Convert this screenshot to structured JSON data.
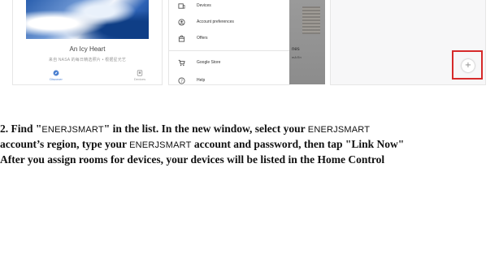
{
  "photo_card": {
    "title": "An Icy Heart",
    "caption": "来自 NASA 的每日精选照片 • 根据星光艺",
    "nav": [
      {
        "label": "Discover",
        "icon": "compass-icon",
        "active": true
      },
      {
        "label": "Devices",
        "icon": "devices-icon",
        "active": false
      }
    ]
  },
  "menu": {
    "items": [
      {
        "label": "Devices",
        "icon": "devices-icon"
      },
      {
        "label": "Account preferences",
        "icon": "account-icon"
      },
      {
        "label": "Offers",
        "icon": "offers-icon"
      },
      {
        "label": "Google Store",
        "icon": "cart-icon"
      },
      {
        "label": "Help",
        "icon": "help-icon"
      }
    ]
  },
  "background_panel": {
    "text1": "nes",
    "text2": "mA En"
  },
  "add_panel": {
    "add_symbol": "+",
    "highlight_color": "#d62a2a"
  },
  "instructions": {
    "l1_a": "2.  Find \"",
    "l1_brand": "ENERJSMART",
    "l1_b": "\" in the list. In the new window, select your ",
    "l1_brand2": "ENERJSMART",
    "l2_a": "account’s region, type your ",
    "l2_brand": "ENERJSMART",
    "l2_b": " account and password, then tap \"Link Now\"",
    "l3": "After you assign rooms for devices, your devices will be listed in the Home Control"
  }
}
